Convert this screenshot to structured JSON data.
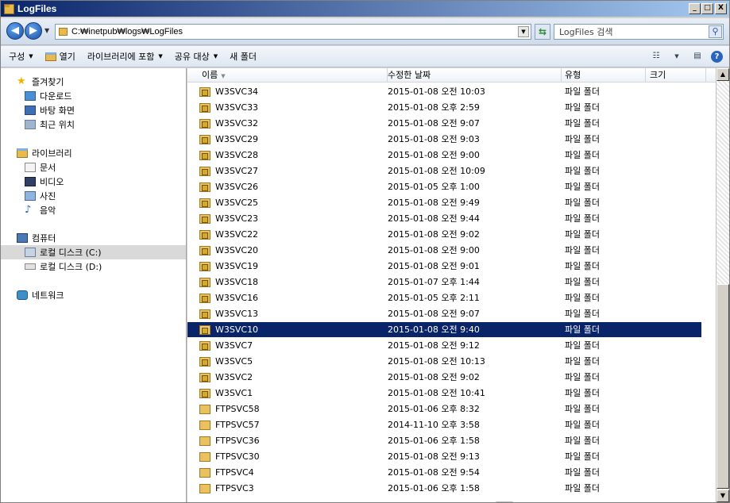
{
  "window": {
    "title": "LogFiles",
    "buttons": [
      "_",
      "□",
      "X"
    ]
  },
  "address": {
    "path": "C:₩inetpub₩logs₩LogFiles",
    "search_placeholder": "LogFiles 검색"
  },
  "commands": {
    "organize": "구성",
    "open": "열기",
    "include_library": "라이브러리에 포함",
    "share_with": "공유 대상",
    "new_folder": "새 폴더"
  },
  "nav": {
    "favorites": "즐겨찾기",
    "downloads": "다운로드",
    "desktop": "바탕 화면",
    "recent": "최근 위치",
    "libraries": "라이브러리",
    "documents": "문서",
    "videos": "비디오",
    "pictures": "사진",
    "music": "음악",
    "computer": "컴퓨터",
    "local_c": "로컬 디스크 (C:)",
    "local_d": "로컬 디스크 (D:)",
    "network": "네트워크"
  },
  "columns": {
    "name": "이름",
    "date": "수정한 날짜",
    "type": "유형",
    "size": "크기"
  },
  "files": [
    {
      "name": "W3SVC34",
      "date": "2015-01-08 오전 10:03",
      "type": "파일 폴더",
      "locked": true
    },
    {
      "name": "W3SVC33",
      "date": "2015-01-08 오후 2:59",
      "type": "파일 폴더",
      "locked": true
    },
    {
      "name": "W3SVC32",
      "date": "2015-01-08 오전 9:07",
      "type": "파일 폴더",
      "locked": true
    },
    {
      "name": "W3SVC29",
      "date": "2015-01-08 오전 9:03",
      "type": "파일 폴더",
      "locked": true
    },
    {
      "name": "W3SVC28",
      "date": "2015-01-08 오전 9:00",
      "type": "파일 폴더",
      "locked": true
    },
    {
      "name": "W3SVC27",
      "date": "2015-01-08 오전 10:09",
      "type": "파일 폴더",
      "locked": true
    },
    {
      "name": "W3SVC26",
      "date": "2015-01-05 오후 1:00",
      "type": "파일 폴더",
      "locked": true
    },
    {
      "name": "W3SVC25",
      "date": "2015-01-08 오전 9:49",
      "type": "파일 폴더",
      "locked": true
    },
    {
      "name": "W3SVC23",
      "date": "2015-01-08 오전 9:44",
      "type": "파일 폴더",
      "locked": true
    },
    {
      "name": "W3SVC22",
      "date": "2015-01-08 오전 9:02",
      "type": "파일 폴더",
      "locked": true
    },
    {
      "name": "W3SVC20",
      "date": "2015-01-08 오전 9:00",
      "type": "파일 폴더",
      "locked": true
    },
    {
      "name": "W3SVC19",
      "date": "2015-01-08 오전 9:01",
      "type": "파일 폴더",
      "locked": true
    },
    {
      "name": "W3SVC18",
      "date": "2015-01-07 오후 1:44",
      "type": "파일 폴더",
      "locked": true
    },
    {
      "name": "W3SVC16",
      "date": "2015-01-05 오후 2:11",
      "type": "파일 폴더",
      "locked": true
    },
    {
      "name": "W3SVC13",
      "date": "2015-01-08 오전 9:07",
      "type": "파일 폴더",
      "locked": true
    },
    {
      "name": "W3SVC10",
      "date": "2015-01-08 오전 9:40",
      "type": "파일 폴더",
      "locked": true,
      "selected": true
    },
    {
      "name": "W3SVC7",
      "date": "2015-01-08 오전 9:12",
      "type": "파일 폴더",
      "locked": true
    },
    {
      "name": "W3SVC5",
      "date": "2015-01-08 오전 10:13",
      "type": "파일 폴더",
      "locked": true
    },
    {
      "name": "W3SVC2",
      "date": "2015-01-08 오전 9:02",
      "type": "파일 폴더",
      "locked": true
    },
    {
      "name": "W3SVC1",
      "date": "2015-01-08 오전 10:41",
      "type": "파일 폴더",
      "locked": true
    },
    {
      "name": "FTPSVC58",
      "date": "2015-01-06 오후 8:32",
      "type": "파일 폴더",
      "locked": false
    },
    {
      "name": "FTPSVC57",
      "date": "2014-11-10 오후 3:58",
      "type": "파일 폴더",
      "locked": false
    },
    {
      "name": "FTPSVC36",
      "date": "2015-01-06 오후 1:58",
      "type": "파일 폴더",
      "locked": false
    },
    {
      "name": "FTPSVC30",
      "date": "2015-01-08 오전 9:13",
      "type": "파일 폴더",
      "locked": false
    },
    {
      "name": "FTPSVC4",
      "date": "2015-01-08 오전 9:54",
      "type": "파일 폴더",
      "locked": false
    },
    {
      "name": "FTPSVC3",
      "date": "2015-01-06 오후 1:58",
      "type": "파일 폴더",
      "locked": false
    }
  ]
}
